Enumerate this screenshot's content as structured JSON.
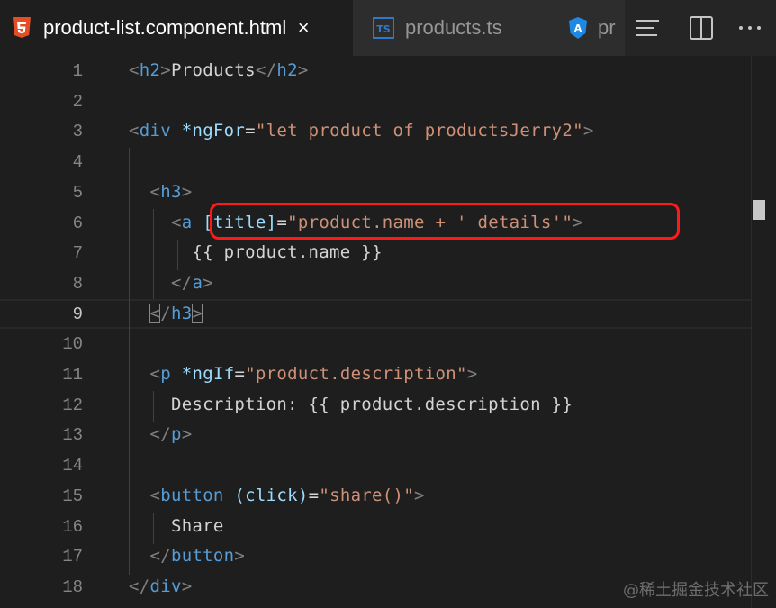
{
  "tabs": [
    {
      "name": "product-list.component.html",
      "icon": "html5-icon",
      "active": true,
      "close": "×"
    },
    {
      "name": "products.ts",
      "icon": "typescript-icon",
      "active": false
    },
    {
      "name": "pr",
      "icon": "angular-icon",
      "active": false
    }
  ],
  "toolbar": {
    "actions": [
      "outline-icon",
      "split-editor-icon",
      "more-actions-icon"
    ]
  },
  "editor": {
    "current_line": 9,
    "line_numbers": [
      "1",
      "2",
      "3",
      "4",
      "5",
      "6",
      "7",
      "8",
      "9",
      "10",
      "11",
      "12",
      "13",
      "14",
      "15",
      "16",
      "17",
      "18"
    ],
    "lines": [
      [
        {
          "t": "<",
          "c": "br"
        },
        {
          "t": "h2",
          "c": "tg"
        },
        {
          "t": ">",
          "c": "br"
        },
        {
          "t": "Products",
          "c": "tx"
        },
        {
          "t": "</",
          "c": "br"
        },
        {
          "t": "h2",
          "c": "tg"
        },
        {
          "t": ">",
          "c": "br"
        }
      ],
      [],
      [
        {
          "t": "<",
          "c": "br"
        },
        {
          "t": "div",
          "c": "tg"
        },
        {
          "t": " ",
          "c": "tx"
        },
        {
          "t": "*ngFor",
          "c": "at"
        },
        {
          "t": "=",
          "c": "tx"
        },
        {
          "t": "\"let product of productsJerry2\"",
          "c": "st"
        },
        {
          "t": ">",
          "c": "br"
        }
      ],
      [],
      [
        {
          "t": "  ",
          "c": "tx"
        },
        {
          "t": "<",
          "c": "br"
        },
        {
          "t": "h3",
          "c": "tg"
        },
        {
          "t": ">",
          "c": "br"
        }
      ],
      [
        {
          "t": "    ",
          "c": "tx"
        },
        {
          "t": "<",
          "c": "br"
        },
        {
          "t": "a",
          "c": "tg"
        },
        {
          "t": " ",
          "c": "tx"
        },
        {
          "t": "[title]",
          "c": "at"
        },
        {
          "t": "=",
          "c": "tx"
        },
        {
          "t": "\"product.name + ' details'\"",
          "c": "st"
        },
        {
          "t": ">",
          "c": "br"
        }
      ],
      [
        {
          "t": "      {{ product.name }}",
          "c": "tx"
        }
      ],
      [
        {
          "t": "    ",
          "c": "tx"
        },
        {
          "t": "</",
          "c": "br"
        },
        {
          "t": "a",
          "c": "tg"
        },
        {
          "t": ">",
          "c": "br"
        }
      ],
      [
        {
          "t": "  ",
          "c": "tx"
        },
        {
          "t": "<",
          "c": "br bm"
        },
        {
          "t": "/",
          "c": "br"
        },
        {
          "t": "h3",
          "c": "tg"
        },
        {
          "t": ">",
          "c": "br bm"
        }
      ],
      [],
      [
        {
          "t": "  ",
          "c": "tx"
        },
        {
          "t": "<",
          "c": "br"
        },
        {
          "t": "p",
          "c": "tg"
        },
        {
          "t": " ",
          "c": "tx"
        },
        {
          "t": "*ngIf",
          "c": "at"
        },
        {
          "t": "=",
          "c": "tx"
        },
        {
          "t": "\"product.description\"",
          "c": "st"
        },
        {
          "t": ">",
          "c": "br"
        }
      ],
      [
        {
          "t": "    Description: {{ product.description }}",
          "c": "tx"
        }
      ],
      [
        {
          "t": "  ",
          "c": "tx"
        },
        {
          "t": "</",
          "c": "br"
        },
        {
          "t": "p",
          "c": "tg"
        },
        {
          "t": ">",
          "c": "br"
        }
      ],
      [],
      [
        {
          "t": "  ",
          "c": "tx"
        },
        {
          "t": "<",
          "c": "br"
        },
        {
          "t": "button",
          "c": "tg"
        },
        {
          "t": " ",
          "c": "tx"
        },
        {
          "t": "(click)",
          "c": "at"
        },
        {
          "t": "=",
          "c": "tx"
        },
        {
          "t": "\"share()\"",
          "c": "st"
        },
        {
          "t": ">",
          "c": "br"
        }
      ],
      [
        {
          "t": "    Share",
          "c": "tx"
        }
      ],
      [
        {
          "t": "  ",
          "c": "tx"
        },
        {
          "t": "</",
          "c": "br"
        },
        {
          "t": "button",
          "c": "tg"
        },
        {
          "t": ">",
          "c": "br"
        }
      ],
      [
        {
          "t": "</",
          "c": "br"
        },
        {
          "t": "div",
          "c": "tg"
        },
        {
          "t": ">",
          "c": "br"
        }
      ]
    ]
  },
  "colors": {
    "accent_highlight": "#ff1a1a",
    "tag": "#569cd6",
    "attribute": "#9cdcfe",
    "string": "#ce9178"
  },
  "watermark": "@稀土掘金技术社区"
}
